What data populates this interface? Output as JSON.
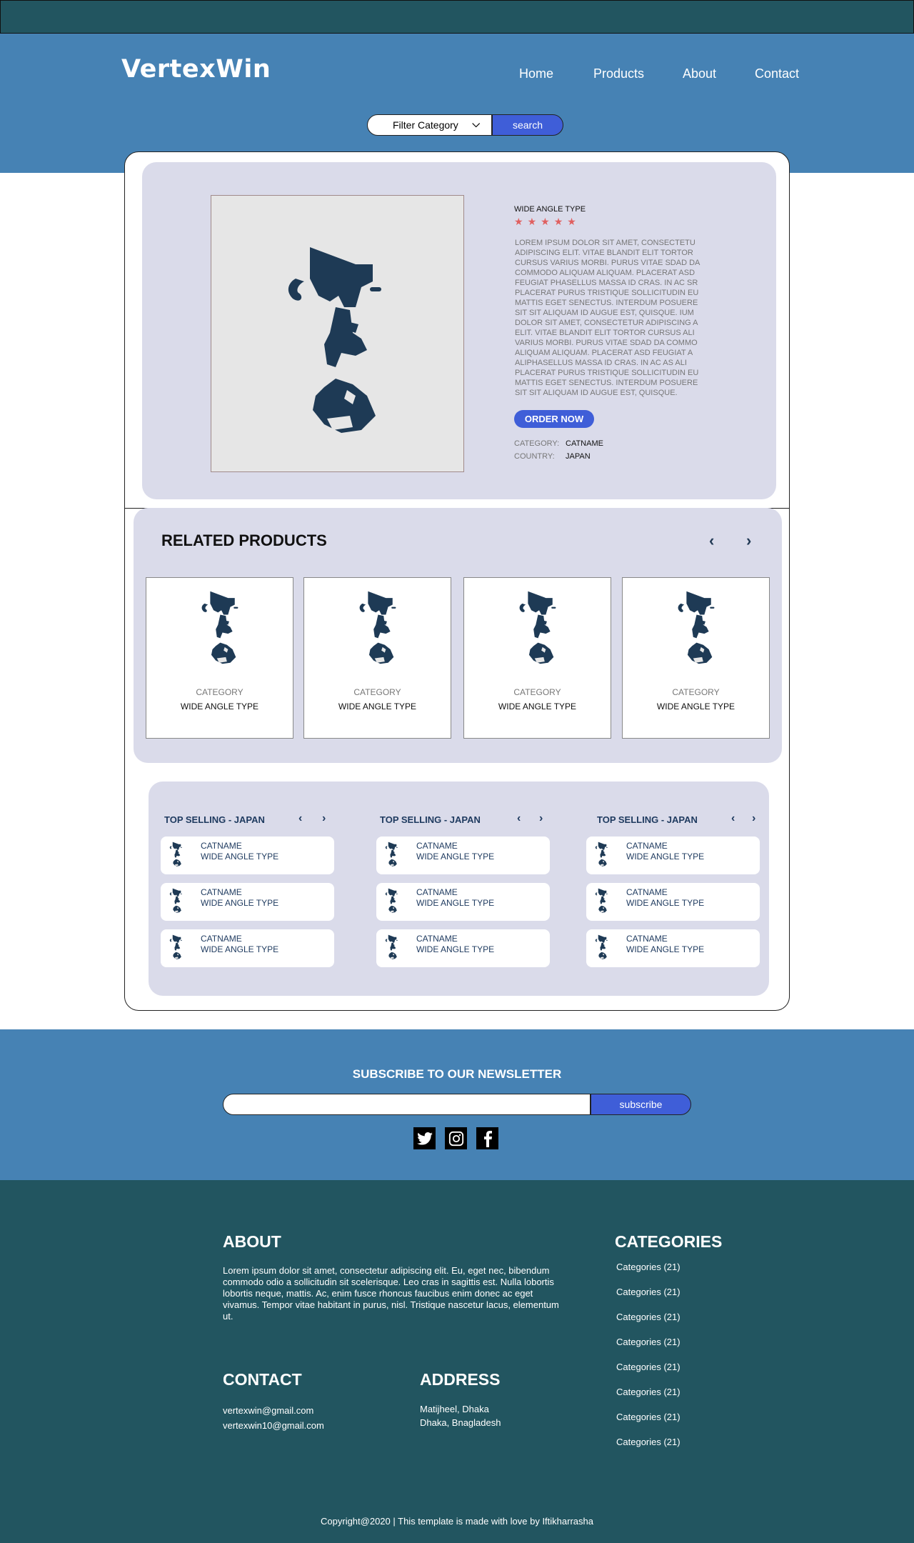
{
  "brand": {
    "name": "VertexWin"
  },
  "nav": {
    "items": [
      "Home",
      "Products",
      "About",
      "Contact"
    ]
  },
  "search": {
    "filter_label": "Filter Category",
    "button_label": "search"
  },
  "product": {
    "title": "WIDE ANGLE TYPE",
    "rating": 5,
    "star_glyph": "★",
    "description": "LOREM IPSUM DOLOR SIT AMET, CONSECTETU ADIPISCING ELIT. VITAE BLANDIT ELIT TORTOR CURSUS VARIUS MORBI. PURUS VITAE SDAD DA COMMODO ALIQUAM ALIQUAM. PLACERAT ASD FEUGIAT PHASELLUS MASSA ID CRAS. IN AC SR PLACERAT PURUS TRISTIQUE SOLLICITUDIN EU MATTIS EGET SENECTUS. INTERDUM POSUERE SIT SIT ALIQUAM ID AUGUE EST, QUISQUE.  IUM DOLOR SIT AMET, CONSECTETUR ADIPISCING A ELIT. VITAE BLANDIT ELIT TORTOR CURSUS ALI VARIUS MORBI. PURUS VITAE SDAD DA COMMO ALIQUAM ALIQUAM. PLACERAT ASD FEUGIAT A ALIPHASELLUS MASSA ID CRAS. IN AC AS ALI PLACERAT PURUS TRISTIQUE SOLLICITUDIN EU MATTIS EGET SENECTUS. INTERDUM POSUERE SIT SIT ALIQUAM ID AUGUE EST, QUISQUE.",
    "order_label": "ORDER NOW",
    "category_key": "CATEGORY:",
    "category_value": "CATNAME",
    "country_key": "COUNTRY:",
    "country_value": "JAPAN"
  },
  "related": {
    "title": "RELATED PRODUCTS",
    "prev_icon": "‹",
    "next_icon": "›",
    "items": [
      {
        "category": "CATEGORY",
        "name": "WIDE ANGLE TYPE"
      },
      {
        "category": "CATEGORY",
        "name": "WIDE ANGLE TYPE"
      },
      {
        "category": "CATEGORY",
        "name": "WIDE ANGLE TYPE"
      },
      {
        "category": "CATEGORY",
        "name": "WIDE ANGLE TYPE"
      }
    ]
  },
  "top_selling": {
    "columns": [
      {
        "title": "TOP SELLING - JAPAN",
        "items": [
          {
            "cat": "CATNAME",
            "name": "WIDE ANGLE TYPE"
          },
          {
            "cat": "CATNAME",
            "name": "WIDE ANGLE TYPE"
          },
          {
            "cat": "CATNAME",
            "name": "WIDE ANGLE TYPE"
          }
        ]
      },
      {
        "title": "TOP SELLING - JAPAN",
        "items": [
          {
            "cat": "CATNAME",
            "name": "WIDE ANGLE TYPE"
          },
          {
            "cat": "CATNAME",
            "name": "WIDE ANGLE TYPE"
          },
          {
            "cat": "CATNAME",
            "name": "WIDE ANGLE TYPE"
          }
        ]
      },
      {
        "title": "TOP SELLING - JAPAN",
        "items": [
          {
            "cat": "CATNAME",
            "name": "WIDE ANGLE TYPE"
          },
          {
            "cat": "CATNAME",
            "name": "WIDE ANGLE TYPE"
          },
          {
            "cat": "CATNAME",
            "name": "WIDE ANGLE TYPE"
          }
        ]
      }
    ]
  },
  "newsletter": {
    "title": "SUBSCRIBE TO OUR NEWSLETTER",
    "input_value": "",
    "button_label": "subscribe",
    "social_icons": [
      "twitter-icon",
      "instagram-icon",
      "facebook-icon"
    ]
  },
  "footer": {
    "about_title": "ABOUT",
    "about_text": "Lorem ipsum dolor sit amet, consectetur adipiscing elit. Eu, eget nec, bibendum commodo odio a sollicitudin sit scelerisque. Leo cras in sagittis est. Nulla lobortis lobortis neque, mattis. Ac, enim fusce rhoncus faucibus enim donec ac eget vivamus. Tempor vitae habitant in purus, nisl. Tristique nascetur lacus, elementum ut.",
    "contact_title": "CONTACT",
    "emails": [
      "vertexwin@gmail.com",
      "vertexwin10@gmail.com"
    ],
    "address_title": "ADDRESS",
    "address_lines": [
      "Matijheel, Dhaka",
      "Dhaka, Bnagladesh"
    ],
    "categories_title": "CATEGORIES",
    "categories": [
      "Categories (21)",
      "Categories (21)",
      "Categories (21)",
      "Categories (21)",
      "Categories (21)",
      "Categories (21)",
      "Categories (21)",
      "Categories (21)"
    ],
    "copyright": "Copyright@2020 | This template is made with love by Iftikharrasha"
  },
  "colors": {
    "dark_teal": "#225560",
    "steel_blue": "#4682b4",
    "accent_blue": "#3f5ed8",
    "card_lavender": "#dadbea",
    "star_red": "#e06060",
    "navy": "#1e3a5f"
  }
}
